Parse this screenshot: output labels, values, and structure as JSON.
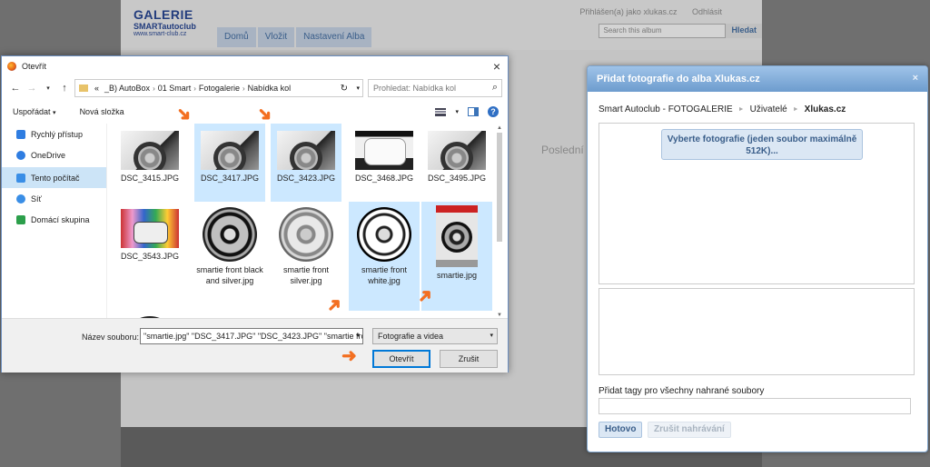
{
  "site": {
    "logo_line1": "GALERIE",
    "logo_line2": "SMARTautoclub",
    "logo_line3": "www.smart-club.cz",
    "nav": [
      "Domů",
      "Vložit",
      "Nastavení Alba"
    ],
    "login_text": "Přihlášen(a) jako xlukas.cz",
    "logout": "Odhlásit",
    "search_placeholder": "Search this album",
    "search_button": "Hledat",
    "bg_text1": "si",
    "bg_text2": "Poslední"
  },
  "open_dialog": {
    "title": "Otevřít",
    "close": "×",
    "breadcrumb": [
      "«",
      "_B) AutoBox",
      "01 Smart",
      "Fotogalerie",
      "Nabídka kol"
    ],
    "search_placeholder": "Prohledat: Nabídka kol",
    "toolbar": {
      "organize": "Uspořádat",
      "new_folder": "Nová složka",
      "help": "?"
    },
    "sidebar": [
      {
        "label": "Rychlý přístup",
        "icon": "star-icon",
        "color": "#2f7de1"
      },
      {
        "label": "OneDrive",
        "icon": "cloud-icon",
        "color": "#2f7de1"
      },
      {
        "label": "Tento počítač",
        "icon": "computer-icon",
        "color": "#3a8ee6",
        "selected": true
      },
      {
        "label": "Síť",
        "icon": "network-icon",
        "color": "#3a8ee6"
      },
      {
        "label": "Domácí skupina",
        "icon": "homegroup-icon",
        "color": "#2c9f4b"
      }
    ],
    "files": [
      {
        "name": "DSC_3415.JPG",
        "selected": false,
        "thumb": "car"
      },
      {
        "name": "DSC_3417.JPG",
        "selected": true,
        "thumb": "car"
      },
      {
        "name": "DSC_3423.JPG",
        "selected": true,
        "thumb": "car"
      },
      {
        "name": "DSC_3468.JPG",
        "selected": false,
        "thumb": "carfront"
      },
      {
        "name": "DSC_3495.JPG",
        "selected": false,
        "thumb": "car"
      },
      {
        "name": "DSC_3543.JPG",
        "selected": false,
        "thumb": "graffiti"
      },
      {
        "name": "smartie front black and silver.jpg",
        "selected": false,
        "thumb": "rim-black"
      },
      {
        "name": "smartie front silver.jpg",
        "selected": false,
        "thumb": "rim-silver"
      },
      {
        "name": "smartie front white.jpg",
        "selected": true,
        "thumb": "rim-white"
      },
      {
        "name": "smartie.jpg",
        "selected": true,
        "thumb": "box"
      }
    ],
    "filename_label": "Název souboru:",
    "filename_value": "\"smartie.jpg\" \"DSC_3417.JPG\" \"DSC_3423.JPG\" \"smartie fron",
    "filetype": "Fotografie a videa",
    "open_button": "Otevřít",
    "cancel_button": "Zrušit"
  },
  "upload_panel": {
    "title": "Přidat fotografie do alba Xlukas.cz",
    "close": "×",
    "breadcrumb": [
      "Smart Autoclub - FOTOGALERIE",
      "Uživatelé",
      "Xlukas.cz"
    ],
    "choose_button": "Vyberte fotografie (jeden soubor maximálně 512K)...",
    "tags_label": "Přidat tagy pro všechny nahrané soubory",
    "done_button": "Hotovo",
    "cancel_upload_button": "Zrušit nahrávání"
  },
  "colors": {
    "accent_arrow": "#f36f21",
    "selection": "#cce8ff",
    "title_blue": "#6d9cce"
  }
}
